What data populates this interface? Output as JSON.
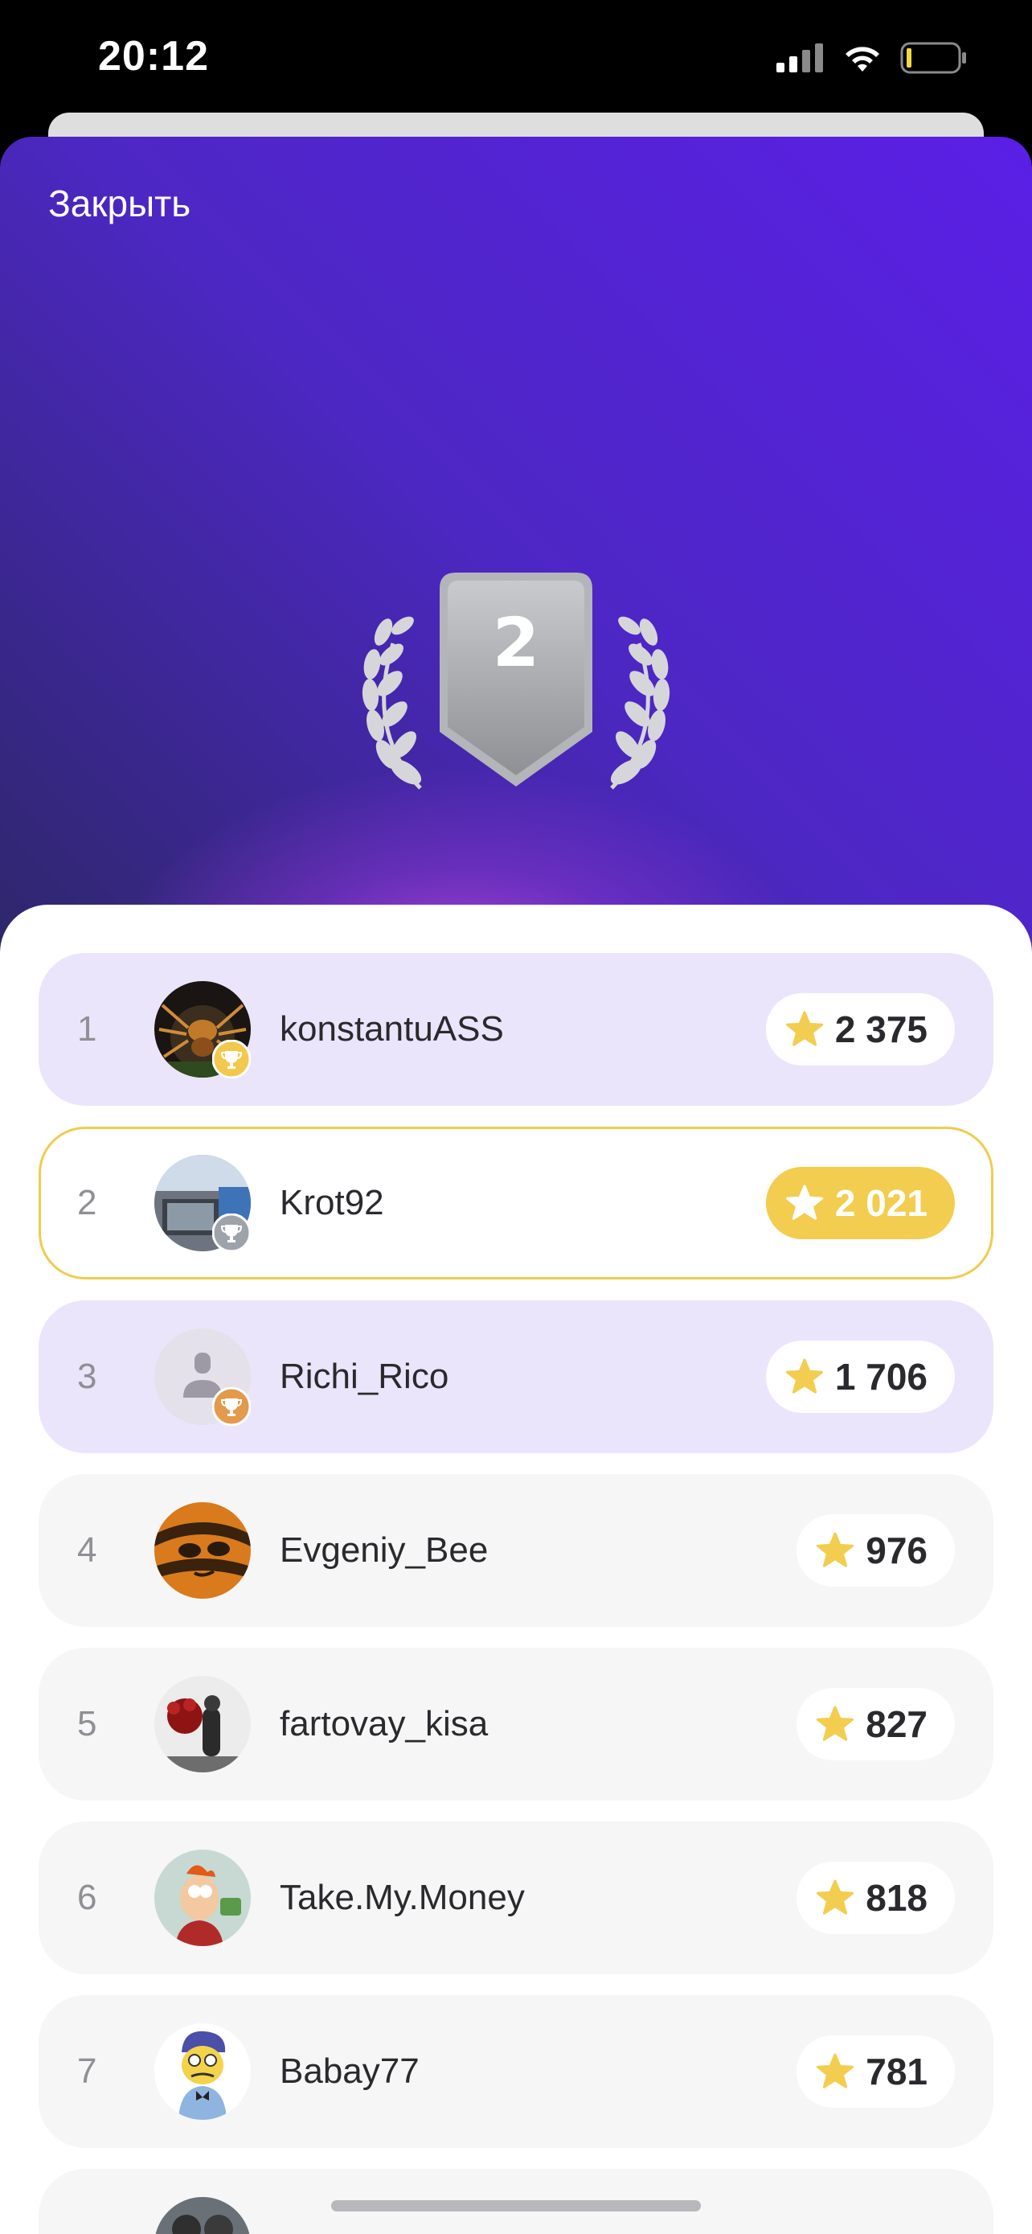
{
  "status_bar": {
    "time": "20:12"
  },
  "header": {
    "close_label": "Закрыть"
  },
  "badge": {
    "place": "2"
  },
  "leaderboard": [
    {
      "rank": "1",
      "name": "konstantuASS",
      "score": "2 375",
      "style": "top3",
      "cup": "gold"
    },
    {
      "rank": "2",
      "name": "Krot92",
      "score": "2 021",
      "style": "me",
      "cup": "silver"
    },
    {
      "rank": "3",
      "name": "Richi_Rico",
      "score": "1 706",
      "style": "top3",
      "cup": "bronze"
    },
    {
      "rank": "4",
      "name": "Evgeniy_Bee",
      "score": "976",
      "style": "normal"
    },
    {
      "rank": "5",
      "name": "fartovay_kisa",
      "score": "827",
      "style": "normal"
    },
    {
      "rank": "6",
      "name": "Take.My.Money",
      "score": "818",
      "style": "normal"
    },
    {
      "rank": "7",
      "name": "Babay77",
      "score": "781",
      "style": "normal"
    }
  ],
  "colors": {
    "accent_star": "#f2cd4f",
    "top3_bg": "#ebe5fb",
    "normal_bg": "#f6f6f6"
  }
}
